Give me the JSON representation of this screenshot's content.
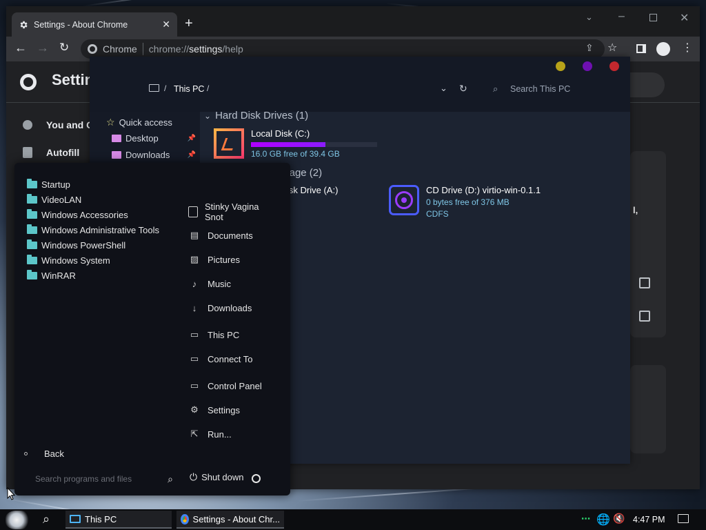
{
  "chrome": {
    "tab_title": "Settings - About Chrome",
    "omnibox_label": "Chrome",
    "url_scheme": "chrome://",
    "url_host": "settings",
    "url_path": "/help",
    "page_title": "Settin",
    "nav_you": "You and G",
    "nav_autofill": "Autofill",
    "fragment_comma": "l,"
  },
  "explorer": {
    "breadcrumb": "This PC",
    "breadcrumb_sep": "/",
    "search_placeholder": "Search This PC",
    "nav": {
      "quick_access": "Quick access",
      "desktop": "Desktop",
      "downloads": "Downloads"
    },
    "groups": {
      "hdd": "Hard Disk Drives (1)",
      "removable": "Removable Storage (2)"
    },
    "drives": {
      "c_name": "Local Disk (C:)",
      "c_free": "16.0 GB free of 39.4 GB",
      "c_used_fraction": 0.59,
      "a_name": "Floppy Disk Drive (A:)",
      "d_name": "CD Drive (D:) virtio-win-0.1.1",
      "d_free": "0 bytes free of 376 MB",
      "d_fs": "CDFS"
    },
    "dots": {
      "yellow": "#b7a219",
      "purple": "#6e10b0",
      "red": "#c3282e"
    }
  },
  "start_menu": {
    "programs": [
      "Startup",
      "VideoLAN",
      "Windows Accessories",
      "Windows Administrative Tools",
      "Windows PowerShell",
      "Windows System",
      "WinRAR"
    ],
    "user_line1": "Stinky Vagina",
    "user_line2": "Snot",
    "places": {
      "documents": "Documents",
      "pictures": "Pictures",
      "music": "Music",
      "downloads": "Downloads",
      "this_pc": "This PC",
      "connect_to": "Connect To",
      "control_panel": "Control Panel",
      "settings": "Settings",
      "run": "Run..."
    },
    "back": "Back",
    "search_placeholder": "Search programs and files",
    "shutdown": "Shut down"
  },
  "taskbar": {
    "explorer_item": "This PC",
    "chrome_item": "Settings - About Chr...",
    "clock": "4:47 PM"
  },
  "colors": {
    "accent": "#b000ff",
    "drive_text": "#7fc6e6",
    "folder": "#5cc6c9"
  }
}
